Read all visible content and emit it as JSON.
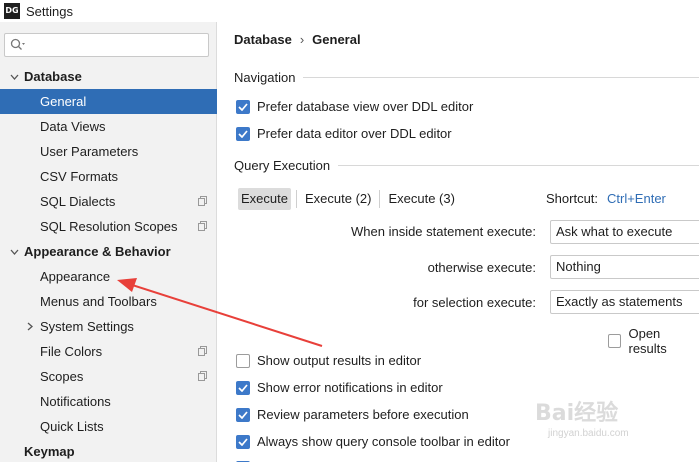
{
  "window": {
    "logo_text": "DG",
    "title": "Settings"
  },
  "sidebar": {
    "search_placeholder": "",
    "tree": [
      {
        "label": "Database",
        "kind": "group"
      },
      {
        "label": "General",
        "kind": "item",
        "selected": true
      },
      {
        "label": "Data Views",
        "kind": "item"
      },
      {
        "label": "User Parameters",
        "kind": "item"
      },
      {
        "label": "CSV Formats",
        "kind": "item"
      },
      {
        "label": "SQL Dialects",
        "kind": "item",
        "copy_icon": true
      },
      {
        "label": "SQL Resolution Scopes",
        "kind": "item",
        "copy_icon": true
      },
      {
        "label": "Appearance & Behavior",
        "kind": "group"
      },
      {
        "label": "Appearance",
        "kind": "item"
      },
      {
        "label": "Menus and Toolbars",
        "kind": "item"
      },
      {
        "label": "System Settings",
        "kind": "item",
        "collapsed": true
      },
      {
        "label": "File Colors",
        "kind": "item",
        "copy_icon": true
      },
      {
        "label": "Scopes",
        "kind": "item",
        "copy_icon": true
      },
      {
        "label": "Notifications",
        "kind": "item"
      },
      {
        "label": "Quick Lists",
        "kind": "item"
      },
      {
        "label": "Keymap",
        "kind": "group"
      }
    ]
  },
  "main": {
    "breadcrumb": [
      "Database",
      "General"
    ],
    "breadcrumb_sep": "›",
    "navigation": {
      "title": "Navigation",
      "options": [
        {
          "label": "Prefer database view over DDL editor",
          "checked": true
        },
        {
          "label": "Prefer data editor over DDL editor",
          "checked": true
        }
      ]
    },
    "query_execution": {
      "title": "Query Execution",
      "tabs": [
        "Execute",
        "Execute (2)",
        "Execute (3)"
      ],
      "shortcut_label": "Shortcut:",
      "shortcut_value": "Ctrl+Enter",
      "when_inside_label": "When inside statement execute:",
      "when_inside_value": "Ask what to execute",
      "otherwise_label": "otherwise execute:",
      "otherwise_value": "Nothing",
      "selection_label": "for selection execute:",
      "selection_value": "Exactly as statements",
      "open_results_label": "Open results"
    },
    "options": [
      {
        "label": "Show output results in editor",
        "checked": false
      },
      {
        "label": "Show error notifications in editor",
        "checked": true
      },
      {
        "label": "Review parameters before execution",
        "checked": true
      },
      {
        "label": "Always show query console toolbar in editor",
        "checked": true
      }
    ]
  },
  "watermark": {
    "text": "Bai经验",
    "sub": "jingyan.baidu.com"
  },
  "colors": {
    "selection": "#2f6db5",
    "checkbox": "#3d79c9",
    "annotation_arrow": "#e8403a"
  }
}
